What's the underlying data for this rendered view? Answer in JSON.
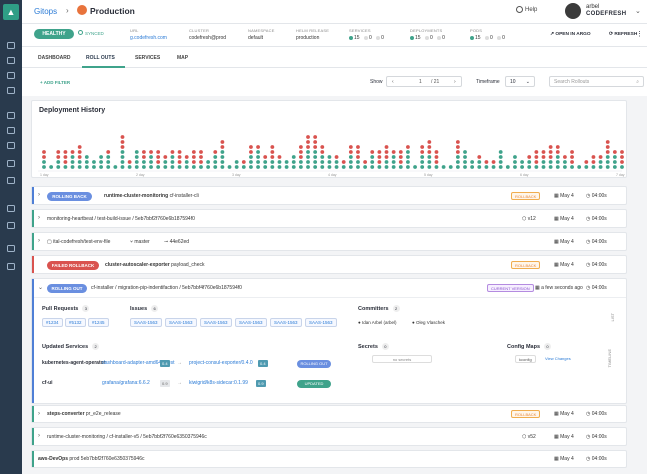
{
  "header": {
    "breadcrumb": "Gitops",
    "app_name": "Production",
    "help": "Help",
    "user_name": "arbel",
    "user_org": "CODEFRESH"
  },
  "status": {
    "health": "HEALTHY",
    "sync": "SYNCED"
  },
  "info": [
    {
      "label": "URL",
      "value": "g.codefresh.com",
      "link": true
    },
    {
      "label": "CLUSTER",
      "value": "codefresh@prod"
    },
    {
      "label": "NAMESPACE",
      "value": "default"
    },
    {
      "label": "HELM RELEASE",
      "value": "production"
    }
  ],
  "counts": [
    {
      "label": "SERVICES",
      "values": [
        "15",
        "0",
        "0"
      ]
    },
    {
      "label": "DEPLOYMENTS",
      "values": [
        "15",
        "0",
        "0"
      ]
    },
    {
      "label": "PODS",
      "values": [
        "15",
        "0",
        "0"
      ]
    }
  ],
  "actions": {
    "open_argo": "OPEN IN ARGO",
    "refresh": "REFRESH"
  },
  "tabs": [
    "DASHBOARD",
    "ROLL OUTS",
    "SERVICES",
    "MAP"
  ],
  "toolbar": {
    "add_filter": "+ ADD FILTER",
    "show": "Show",
    "page": "1",
    "total": "/ 21",
    "timeframe_label": "Timeframe",
    "timeframe": "10",
    "search_placeholder": "Search Rollouts"
  },
  "history": {
    "title": "Deployment History",
    "axis": [
      "1 day",
      "2 day",
      "3 day",
      "4 day",
      "5 day",
      "6 day",
      "7 day"
    ]
  },
  "rows": [
    {
      "pill": "ROLLING BACK",
      "title": "runtime-cluster-monitoring",
      "sub": "cf-installer-cli",
      "tag": "ROLLBACK",
      "date": "May 4",
      "time": "04:00s"
    },
    {
      "title": "monitoring-heartbeat / test-build-issue / 5eb7bbf2f760e6b187594f0",
      "ver": "v12",
      "date": "May 4",
      "time": "04:00s"
    },
    {
      "title": "ital-codefresh/test-env-file",
      "branch": "master",
      "commit": "44e62ed",
      "date": "May 4",
      "time": "04:00s"
    },
    {
      "pill": "FAILED ROLLBACK",
      "title": "cluster-autoscaler-exporter",
      "sub": "payload_check",
      "tag": "ROLLBACK",
      "date": "May 4",
      "time": "04:00s"
    },
    {
      "pill": "ROLLING OUT",
      "title": "cf-installer / migration-pip-indentifaction / 5eb7bbf4f760e6b187594f0",
      "tag": "CURRENT VERSION",
      "date": "a few seconds ago",
      "time": "04:00s"
    }
  ],
  "details": {
    "pr_title": "Pull Requests",
    "pr_count": "3",
    "prs": [
      "#1234",
      "#5132",
      "#1245"
    ],
    "issues_title": "Issues",
    "issues_count": "6",
    "issues": [
      "SAAS-1563",
      "SAAS-1563",
      "SAAS-1563",
      "SAAS-1563",
      "SAAS-1563",
      "SAAS-1563"
    ],
    "committers_title": "Committers",
    "committers_count": "2",
    "committers": [
      "Idan Arbel (arbel)",
      "Oleg Vlaschek"
    ],
    "svc_title": "Updated Services",
    "svc_count": "2",
    "services": [
      {
        "name": "kubernetes-agent-operator",
        "from": "dashboard-adapter-amd64/latest",
        "v1": "0.4",
        "to": "project-consul-exporter/0.4.0",
        "v2": "0.4",
        "status": "ROLLING OUT"
      },
      {
        "name": "cf-ui",
        "from": "grafana/grafana:6.6.2",
        "v1": "0.9",
        "to": "kiwigrid/k8s-sidecar:0.1.99",
        "v2": "0.9",
        "status": "UPDATED"
      }
    ],
    "secrets_title": "Secrets",
    "secrets_count": "0",
    "no_secrets": "no secrets",
    "cm_title": "Config Maps",
    "cm_count": "0",
    "cm_item": "kconfig",
    "cm_link": "View Changes",
    "side1": "LIST",
    "side2": "TIMELINE"
  },
  "rows_bottom": [
    {
      "title": "steps-converter",
      "sub": "pr_e2e_release",
      "tag": "ROLLBACK",
      "date": "May 4",
      "time": "04:00s"
    },
    {
      "title": "runtime-cluster-monitoring / cf-installer-v5 / 5eb7bbf2f760e6350375946c",
      "ver": "v52",
      "date": "May 4",
      "time": "04:00s"
    },
    {
      "title": "aws-DevOps",
      "sub": "prod 5eb7bbf2f760e6350375946c",
      "date": "May 4",
      "time": "04:00s"
    }
  ]
}
